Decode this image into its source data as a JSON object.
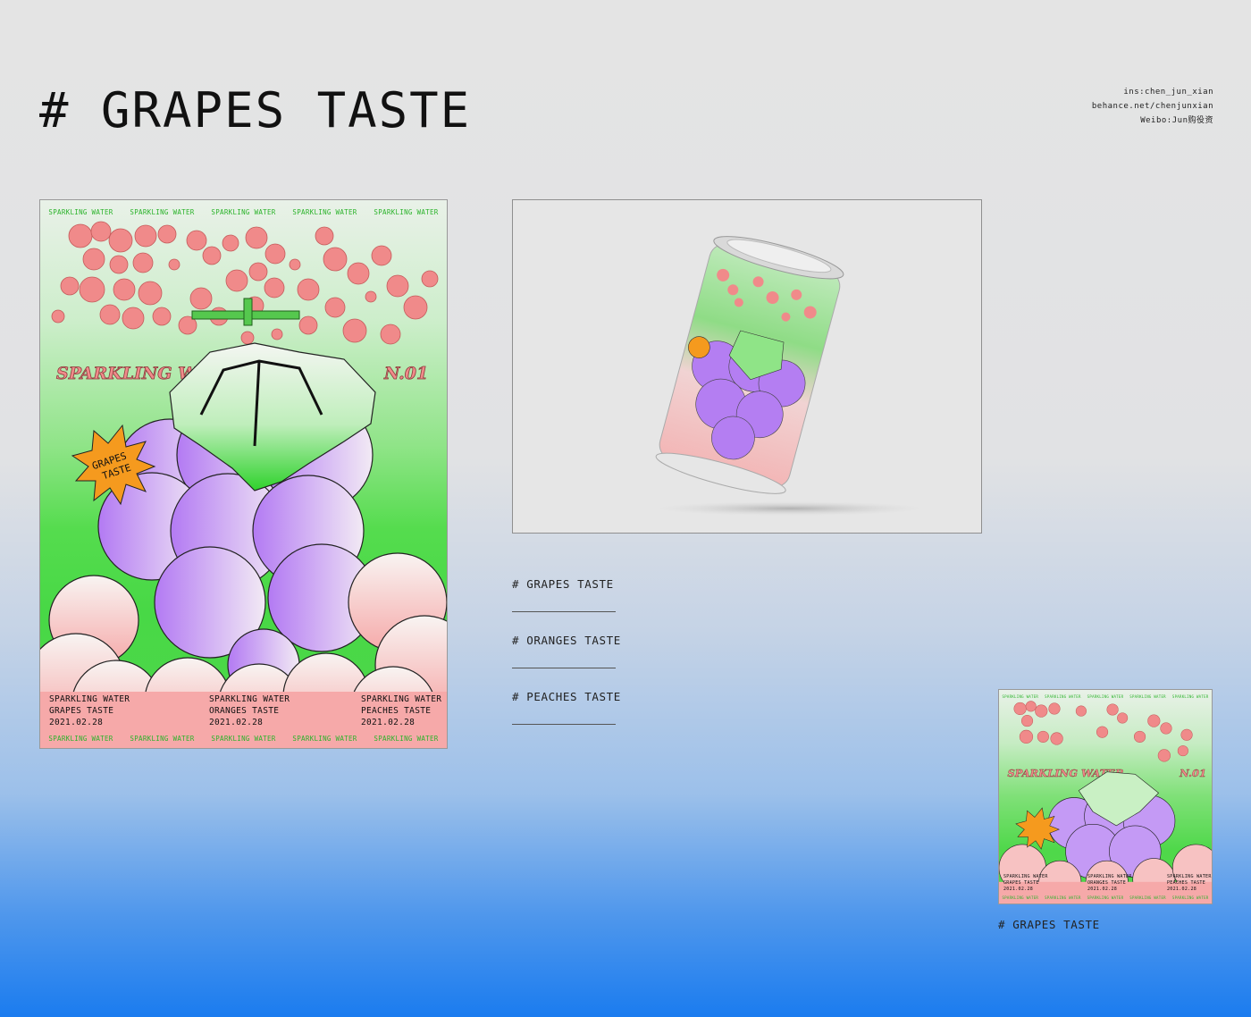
{
  "header": {
    "title": "# GRAPES TASTE",
    "credits": [
      "ins:chen_jun_xian",
      "behance.net/chenjunxian",
      "Weibo:Jun购役资"
    ]
  },
  "poster": {
    "strip_label": "SPARKLING WATER",
    "brand_line": "SPARKLING WATER",
    "number": "N.01",
    "badge": [
      "GRAPES",
      "TASTE"
    ],
    "captions": [
      {
        "line1": "SPARKLING WATER",
        "line2": "GRAPES TASTE",
        "line3": "2021.02.28"
      },
      {
        "line1": "SPARKLING WATER",
        "line2": "ORANGES TASTE",
        "line3": "2021.02.28"
      },
      {
        "line1": "SPARKLING WATER",
        "line2": "PEACHES TASTE",
        "line3": "2021.02.28"
      }
    ]
  },
  "menu": {
    "items": [
      "# GRAPES TASTE",
      "# ORANGES TASTE",
      "# PEACHES TASTE"
    ]
  },
  "thumbnail": {
    "label": "# GRAPES TASTE"
  },
  "colors": {
    "bubble_pink": "#f08a8a",
    "grape_purple": "#b47ef2",
    "leaf_green": "#4fd84a",
    "cloud_pink": "#f7b6b6",
    "badge_orange": "#f59a1e"
  }
}
